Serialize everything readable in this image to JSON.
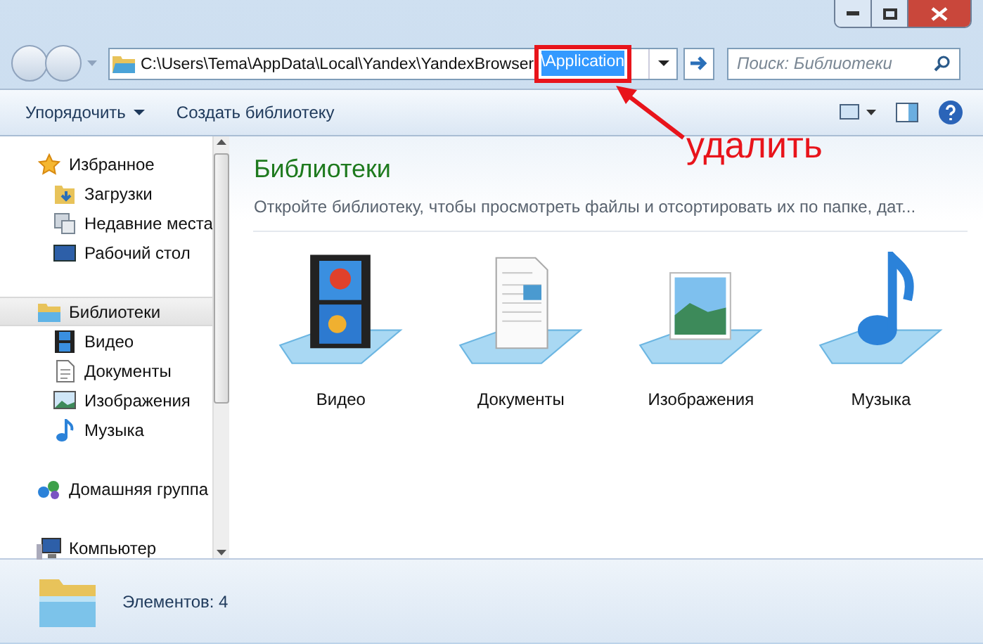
{
  "address": {
    "path": "C:\\Users\\Tema\\AppData\\Local\\Yandex\\YandexBrowser",
    "selected_part": "\\Application"
  },
  "search": {
    "placeholder": "Поиск: Библиотеки"
  },
  "toolbar": {
    "buttons": [
      "Упорядочить",
      "Создать библиотеку"
    ]
  },
  "sidebar": {
    "groups": [
      {
        "label": "Избранное",
        "kind": "favorites",
        "selected": false,
        "children": [
          {
            "label": "Загрузки",
            "kind": "downloads"
          },
          {
            "label": "Недавние места",
            "kind": "recent"
          },
          {
            "label": "Рабочий стол",
            "kind": "desktop"
          }
        ]
      },
      {
        "label": "Библиотеки",
        "kind": "libraries",
        "selected": true,
        "children": [
          {
            "label": "Видео",
            "kind": "video"
          },
          {
            "label": "Документы",
            "kind": "documents"
          },
          {
            "label": "Изображения",
            "kind": "pictures"
          },
          {
            "label": "Музыка",
            "kind": "music"
          }
        ]
      },
      {
        "label": "Домашняя группа",
        "kind": "homegroup",
        "selected": false
      },
      {
        "label": "Компьютер",
        "kind": "computer",
        "selected": false
      }
    ]
  },
  "content": {
    "title": "Библиотеки",
    "subtitle": "Откройте библиотеку, чтобы просмотреть файлы и отсортировать их по папке, дат...",
    "libraries": [
      {
        "label": "Видео",
        "kind": "video"
      },
      {
        "label": "Документы",
        "kind": "documents"
      },
      {
        "label": "Изображения",
        "kind": "pictures"
      },
      {
        "label": "Музыка",
        "kind": "music"
      }
    ]
  },
  "status_bar": {
    "text": "Элементов: 4"
  },
  "annotation": {
    "label": "удалить"
  }
}
